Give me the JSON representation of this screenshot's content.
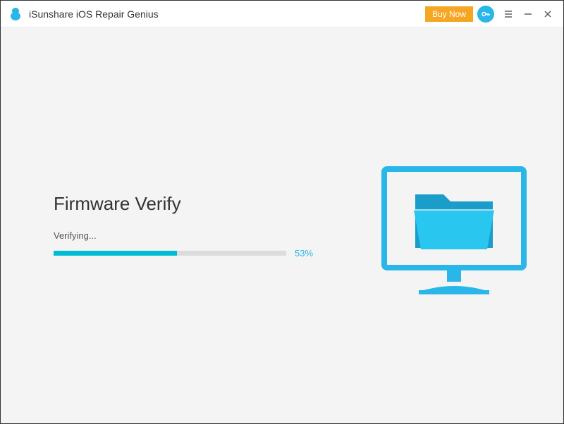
{
  "titlebar": {
    "app_title": "iSunshare iOS Repair Genius",
    "buy_now_label": "Buy Now"
  },
  "main": {
    "heading": "Firmware Verify",
    "status": "Verifying...",
    "progress_percent": 53,
    "percent_label": "53%"
  },
  "colors": {
    "accent": "#29b6e8",
    "progress": "#00bcd4",
    "buy_button": "#f5a623"
  }
}
